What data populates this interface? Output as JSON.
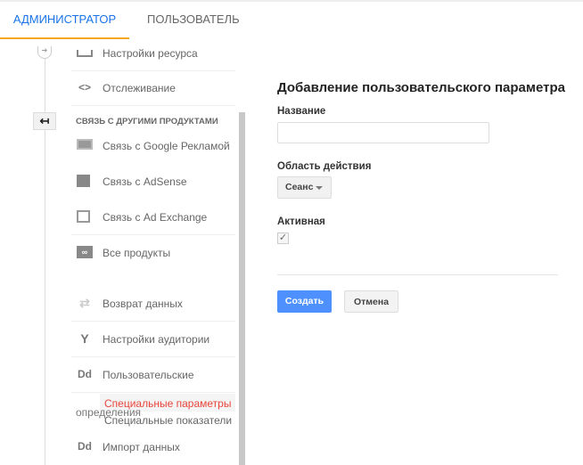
{
  "tabs": [
    {
      "label": "Администратор",
      "active": true
    },
    {
      "label": "Пользователь",
      "active": false
    }
  ],
  "nav": {
    "items": [
      {
        "label": "Настройки ресурса",
        "icon": "property-settings-icon"
      },
      {
        "label": "Отслеживание",
        "icon": "code-icon"
      }
    ],
    "section_header": "Связь с другими продуктами",
    "linked": [
      {
        "label": "Связь с Google Рекламой",
        "icon": "ads-icon"
      },
      {
        "label": "Связь с AdSense",
        "icon": "adsense-icon"
      },
      {
        "label": "Связь с Ad Exchange",
        "icon": "adexchange-icon"
      },
      {
        "label": "Все продукты",
        "icon": "all-products-icon"
      },
      {
        "label": "Возврат данных",
        "icon": "postbacks-icon"
      },
      {
        "label": "Настройки аудитории",
        "icon": "audience-icon"
      },
      {
        "label": "Пользовательские",
        "icon": "dd-icon"
      }
    ],
    "custom_suffix": "определения",
    "sub_items": [
      {
        "label": "Специальные параметры",
        "active": true
      },
      {
        "label": "Специальные показатели",
        "active": false
      }
    ],
    "import": {
      "label": "Импорт данных",
      "icon": "dd-icon"
    }
  },
  "form": {
    "title": "Добавление пользовательского параметра",
    "name_label": "Название",
    "name_value": "",
    "name_placeholder": "",
    "scope_label": "Область действия",
    "scope_value": "Сеанс",
    "active_label": "Активная",
    "active_checked": true,
    "create": "Создать",
    "cancel": "Отмена"
  },
  "colors": {
    "accent": "#1a73e8",
    "active_item": "#e8453c",
    "tab_underline": "#f5a623",
    "primary_button": "#4d90fe"
  }
}
